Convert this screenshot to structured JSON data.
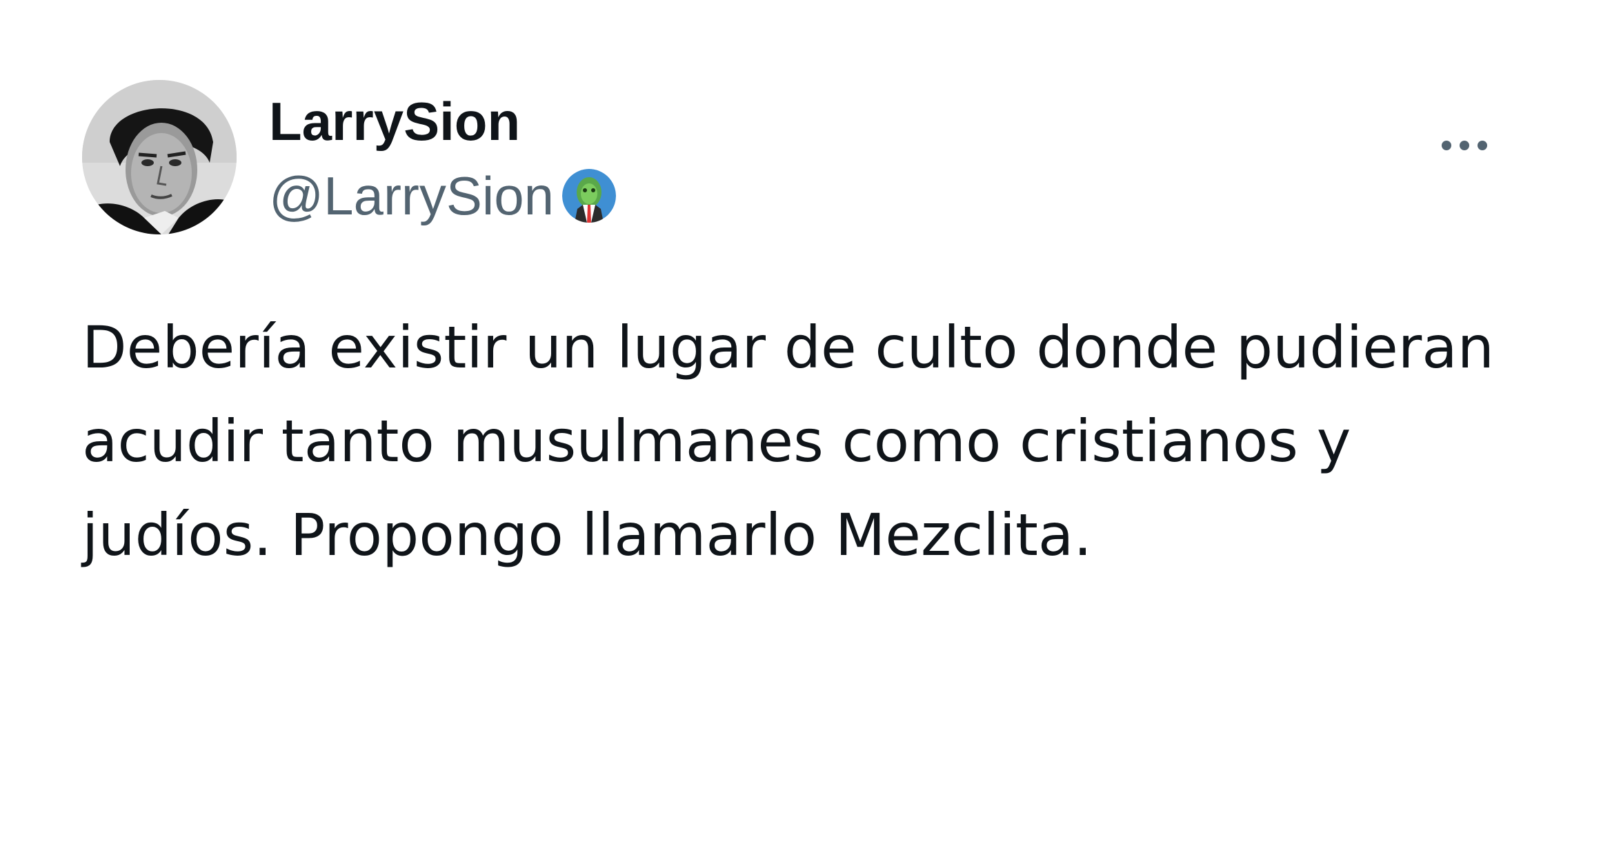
{
  "author": {
    "display_name": "LarrySion",
    "handle": "@LarrySion",
    "avatar_icon": "profile-photo-man-portrait-bw",
    "badge_icon": "green-face-with-blue-background"
  },
  "more_icon": "more-horizontal-icon",
  "tweet": {
    "text": "Debería existir un lugar de culto donde pudieran\nacudir tanto musulmanes como cristianos y\njudíos. Propongo llamarlo Mezclita."
  },
  "colors": {
    "text_primary": "#0f1419",
    "text_secondary": "#536471",
    "background": "#ffffff"
  }
}
